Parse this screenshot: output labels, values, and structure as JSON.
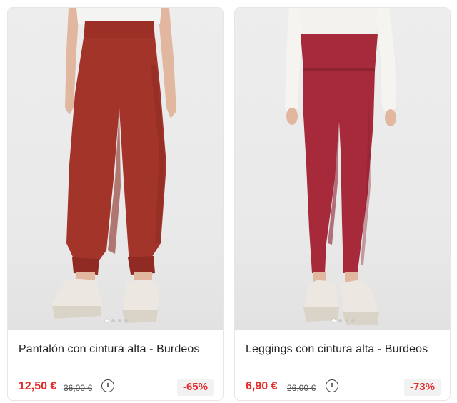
{
  "products": [
    {
      "title": "Pantalón con cintura alta - Burdeos",
      "price": "12,50 €",
      "old_price": "36,00 €",
      "discount": "-65%",
      "info_icon": "info-circle-icon",
      "accent": "#e62b2b",
      "garment_color": "#a3342a"
    },
    {
      "title": "Leggings con cintura alta - Burdeos",
      "price": "6,90 €",
      "old_price": "26,00 €",
      "discount": "-73%",
      "info_icon": "info-circle-icon",
      "accent": "#e62b2b",
      "garment_color": "#a72a3a"
    }
  ]
}
